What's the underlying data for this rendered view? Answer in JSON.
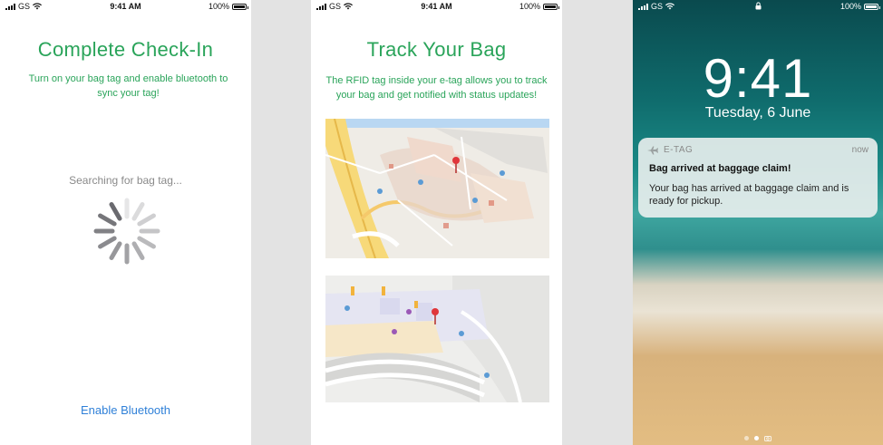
{
  "status_bar": {
    "carrier": "GS",
    "time": "9:41 AM",
    "battery": "100%",
    "battery_level": 1.0
  },
  "screen1": {
    "title": "Complete Check-In",
    "subtitle": "Turn on your bag tag and enable bluetooth to sync your tag!",
    "searching": "Searching for bag tag...",
    "enable_bluetooth": "Enable Bluetooth"
  },
  "screen2": {
    "title": "Track Your Bag",
    "subtitle": "The RFID tag inside your e-tag allows you to track your bag and get notified with status updates!"
  },
  "lock_screen": {
    "time": "9:41",
    "date": "Tuesday, 6 June",
    "notification": {
      "app": "E-TAG",
      "time": "now",
      "title": "Bag arrived at baggage claim!",
      "body": "Your bag has arrived at baggage claim and is ready for pickup."
    },
    "page_count": 3,
    "active_page": 1
  },
  "colors": {
    "accent_green": "#2aa45a",
    "link_blue": "#2f80d8",
    "pin_red": "#e0363b"
  },
  "icons": [
    "signal-icon",
    "wifi-icon",
    "battery-icon",
    "lock-icon",
    "airplane-icon",
    "map-pin-icon",
    "spinner-icon",
    "camera-icon"
  ]
}
